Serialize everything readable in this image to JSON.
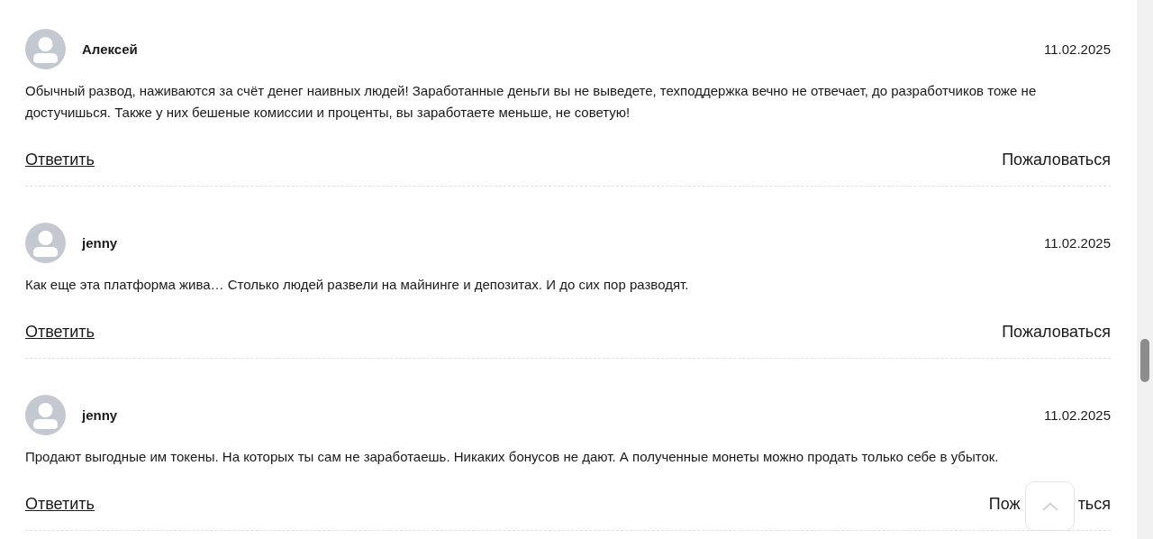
{
  "comments": [
    {
      "author": "Алексей",
      "date": "11.02.2025",
      "text": "Обычный развод, наживаются за счёт денег наивных людей! Заработанные деньги вы не выведете, техподдержка вечно не отвечает, до разработчиков тоже не достучишься. Также у них бешеные комиссии и проценты, вы заработаете меньше, не советую!",
      "reply": "Ответить",
      "report": [
        "Пожаловаться"
      ]
    },
    {
      "author": "jenny",
      "date": "11.02.2025",
      "text": "Как еще эта платформа жива… Столько людей развели на майнинге и депозитах. И до сих пор разводят.",
      "reply": "Ответить",
      "report": [
        "Пожаловаться"
      ]
    },
    {
      "author": "jenny",
      "date": "11.02.2025",
      "text": "Продают выгодные им токены. На которых ты сам не заработаешь. Никаких бонусов не дают. А полученные монеты можно продать только себе в убыток.",
      "reply": "Ответить",
      "report": [
        "Пож",
        "ться"
      ]
    }
  ]
}
